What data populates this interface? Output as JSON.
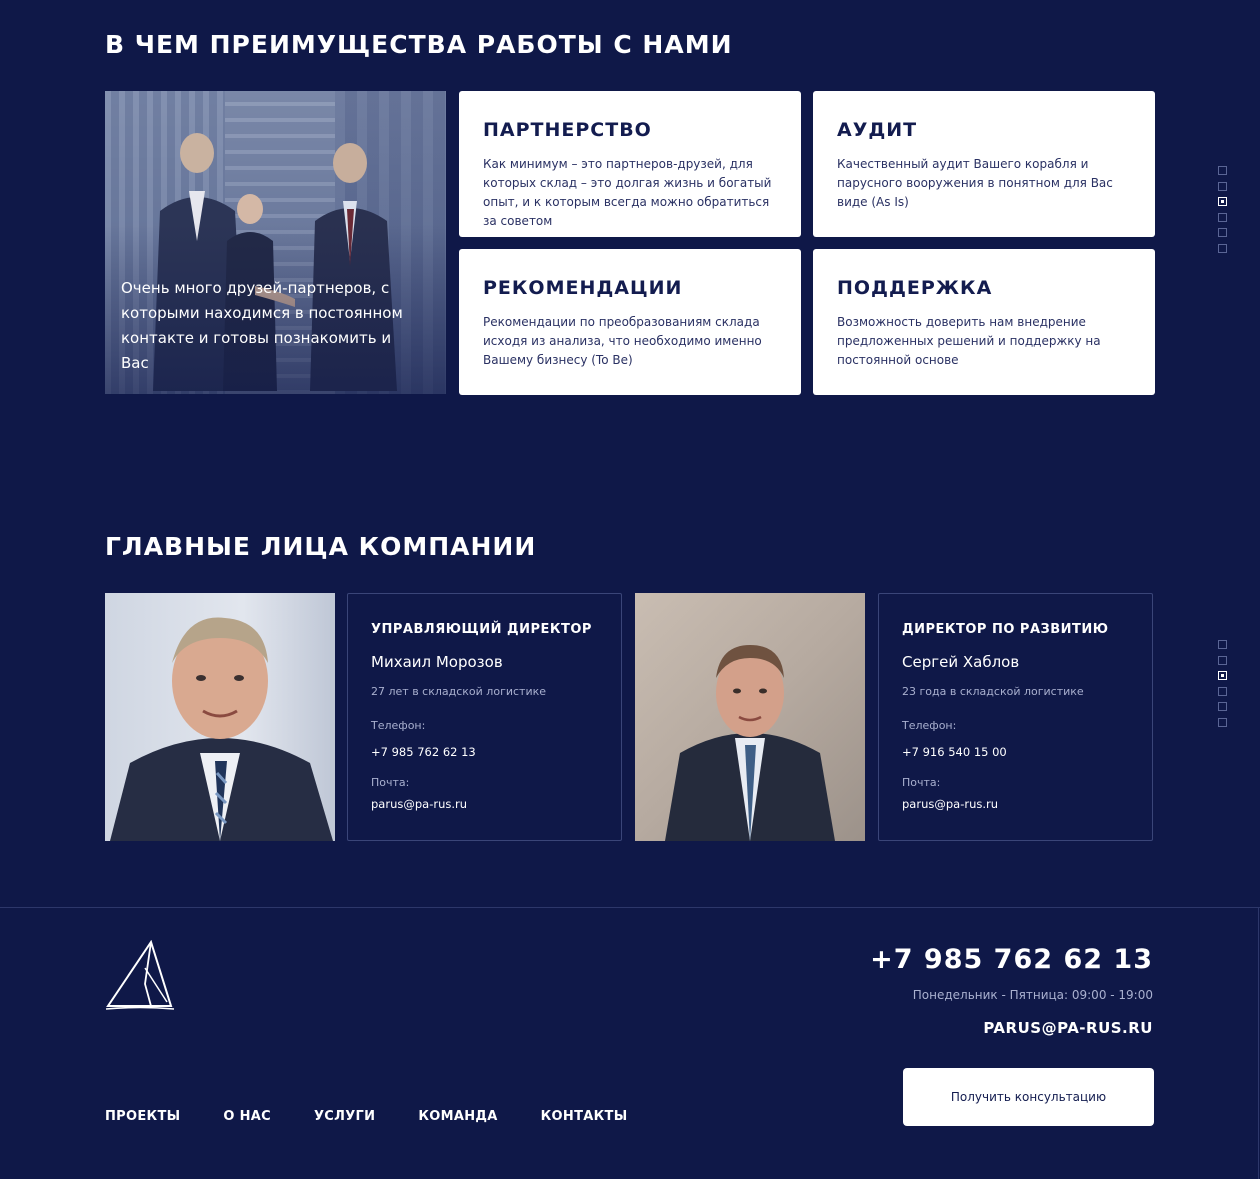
{
  "advantages": {
    "title": "В ЧЕМ ПРЕИМУЩЕСТВА РАБОТЫ С НАМИ",
    "photo_caption": "Очень много друзей-партнеров, с которыми находимся в постоянном контакте и готовы познакомить и Вас",
    "cards": [
      {
        "title": "ПАРТНЕРСТВО",
        "text": "Как минимум – это партнеров-друзей, для которых склад – это долгая жизнь и богатый опыт, и к которым всегда можно обратиться за советом"
      },
      {
        "title": "АУДИТ",
        "text": "Качественный аудит Вашего корабля и парусного вооружения в понятном для Вас виде (As Is)"
      },
      {
        "title": "РЕКОМЕНДАЦИИ",
        "text": "Рекомендации по преобразованиям склада исходя из анализа, что необходимо именно Вашему бизнесу (To Be)"
      },
      {
        "title": "ПОДДЕРЖКА",
        "text": "Возможность доверить нам внедрение предложенных решений и поддержку на постоянной основе"
      }
    ]
  },
  "pagination": {
    "count": 6,
    "active_index": 2
  },
  "team": {
    "title": "ГЛАВНЫЕ ЛИЦА КОМПАНИИ",
    "members": [
      {
        "role": "УПРАВЛЯЮЩИЙ ДИРЕКТОР",
        "name": "Михаил Морозов",
        "experience": "27 лет в складской логистике",
        "phone_label": "Телефон:",
        "phone": "+7 985 762 62 13",
        "email_label": "Почта:",
        "email": "parus@pa-rus.ru"
      },
      {
        "role": "ДИРЕКТОР ПО РАЗВИТИЮ",
        "name": "Сергей Хаблов",
        "experience": "23 года в складской логистике",
        "phone_label": "Телефон:",
        "phone": "+7 916 540 15 00",
        "email_label": "Почта:",
        "email": "parus@pa-rus.ru"
      }
    ]
  },
  "footer": {
    "phone": "+7 985 762 62 13",
    "hours": "Понедельник - Пятница: 09:00 - 19:00",
    "email": "PARUS@PA-RUS.RU",
    "cta_label": "Получить консультацию",
    "nav": [
      "ПРОЕКТЫ",
      "О НАС",
      "УСЛУГИ",
      "КОМАНДА",
      "КОНТАКТЫ"
    ]
  },
  "colors": {
    "background": "#0f1848",
    "card": "#ffffff",
    "card_text": "#131c4f",
    "muted": "#a9b0cf"
  }
}
